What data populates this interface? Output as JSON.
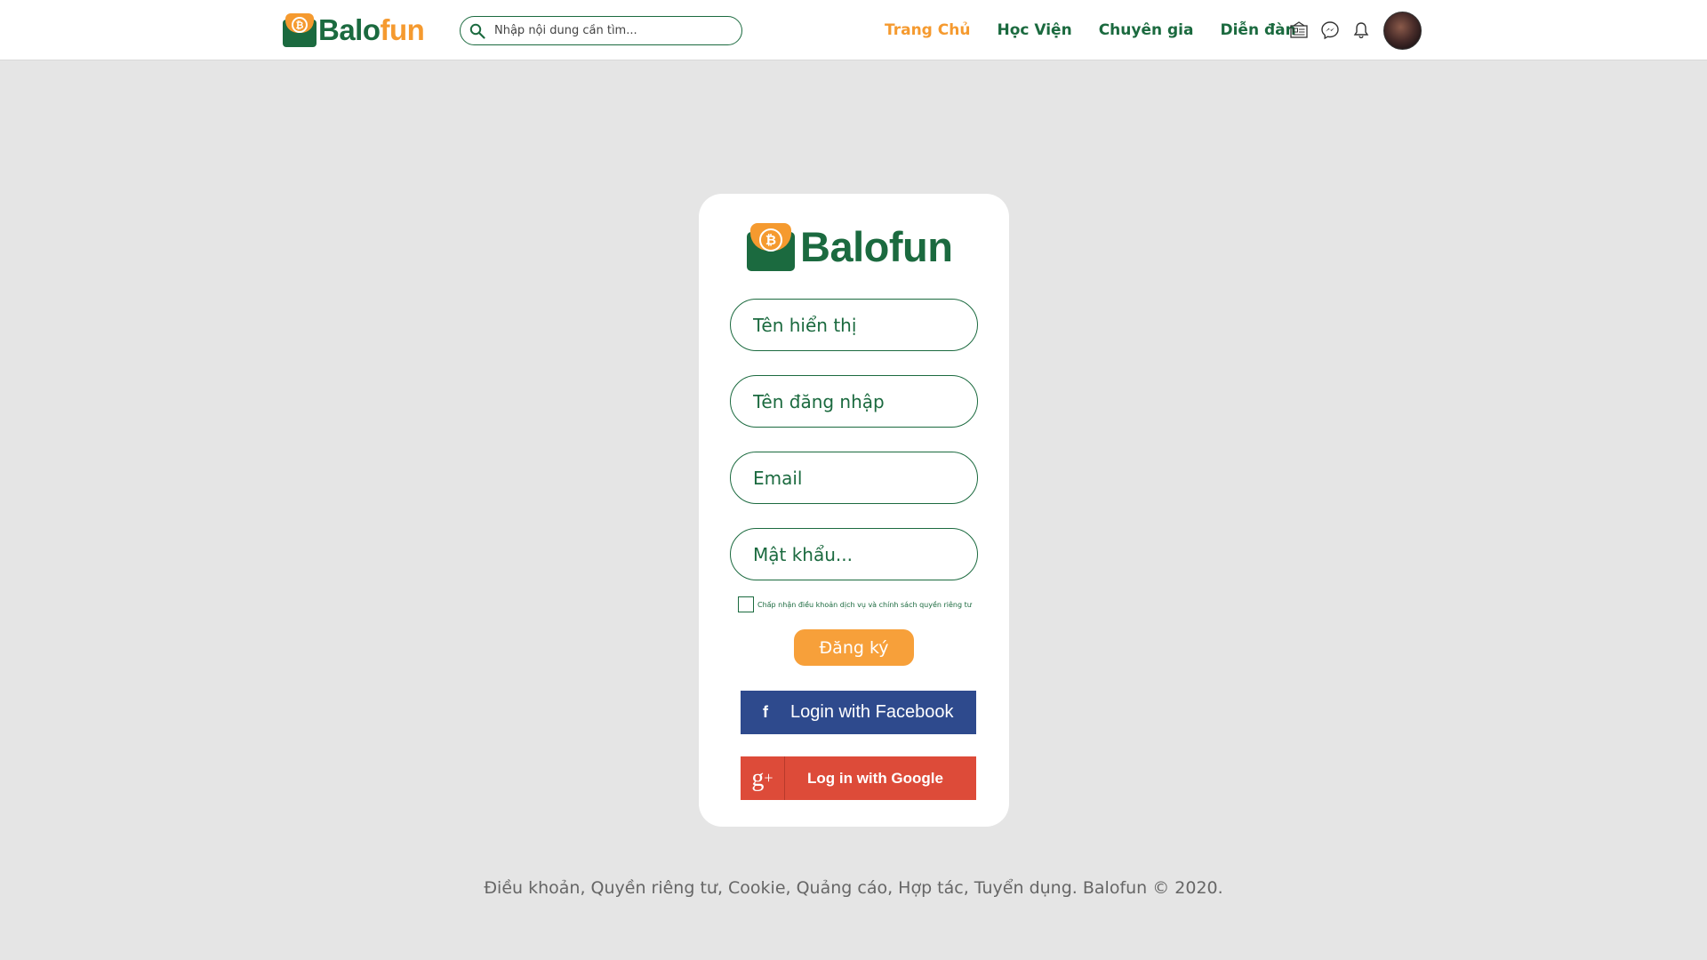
{
  "header": {
    "logo_part1": "Balo",
    "logo_part2": "fun",
    "search_placeholder": "Nhập nội dung cần tìm...",
    "nav": [
      {
        "label": "Trang Chủ",
        "active": true
      },
      {
        "label": "Học Viện",
        "active": false
      },
      {
        "label": "Chuyên gia",
        "active": false
      },
      {
        "label": "Diễn đàn",
        "active": false
      }
    ],
    "icons": [
      "newspaper-icon",
      "messenger-icon",
      "bell-icon"
    ]
  },
  "form": {
    "logo_text": "Balofun",
    "display_name_placeholder": "Tên hiển thị",
    "username_placeholder": "Tên đăng nhập",
    "email_placeholder": "Email",
    "password_placeholder": "Mật khẩu...",
    "terms_label": "Chấp nhận điều khoản dịch vụ và chính sách quyền riêng tư",
    "terms_checked": false,
    "register_label": "Đăng ký",
    "facebook_label": "Login with Facebook",
    "google_label": "Log in with Google"
  },
  "footer": {
    "text": "Điều khoản, Quyền riêng tư, Cookie, Quảng cáo, Hợp tác, Tuyển dụng. Balofun © 2020."
  },
  "colors": {
    "brand_green": "#1b6a3f",
    "brand_orange": "#f59a2f",
    "facebook": "#2e4a8d",
    "google": "#dd4b39",
    "background": "#e5e5e5"
  }
}
